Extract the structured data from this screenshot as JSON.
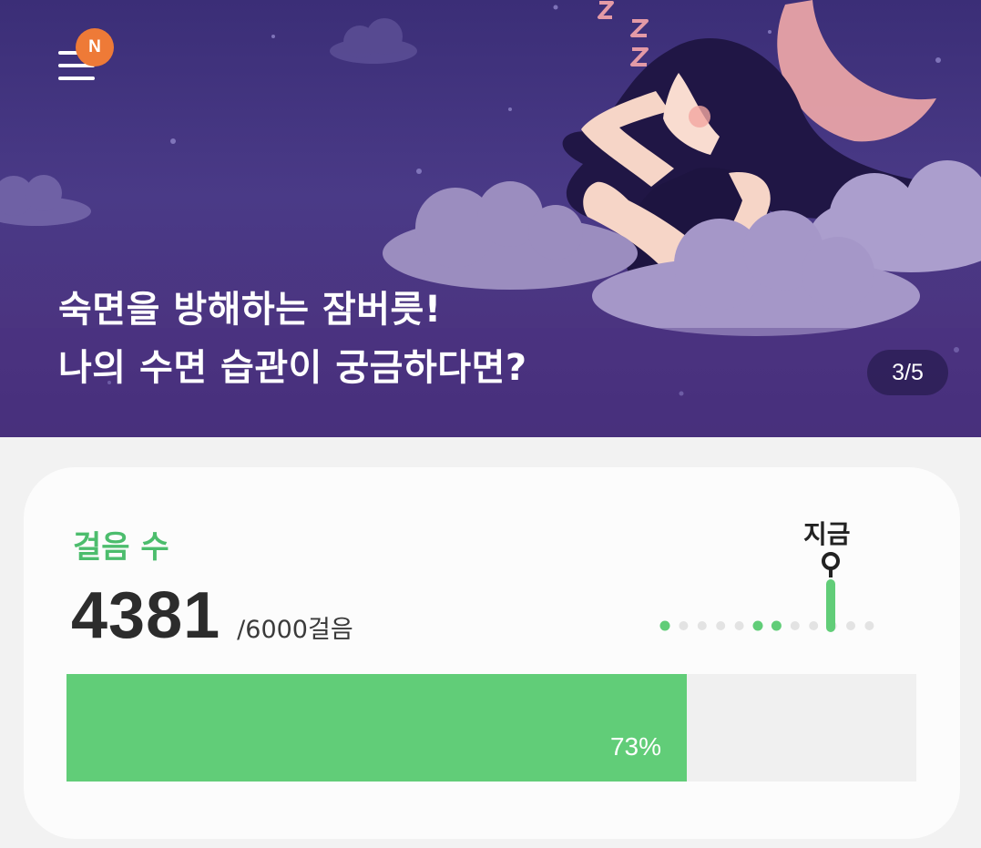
{
  "banner": {
    "menu_icon": "hamburger-menu-icon",
    "new_badge": "N",
    "title_line1": "숙면을 방해하는 잠버릇!",
    "title_line2": "나의 수면 습관이 궁금하다면?",
    "pager": "3/5",
    "colors": {
      "badge": "#ee7a37",
      "background": "#47307a"
    }
  },
  "steps": {
    "title": "걸음 수",
    "value": "4381",
    "goal": "/6000걸음",
    "now_label": "지금",
    "progress_percent": 73,
    "progress_label": "73%",
    "timeline_dots_active": [
      true,
      false,
      false,
      false,
      false,
      true,
      true,
      false,
      false,
      false,
      false,
      false
    ],
    "colors": {
      "accent": "#4cbd6d",
      "fill": "#61cd78",
      "track": "#f0f0f0"
    }
  }
}
